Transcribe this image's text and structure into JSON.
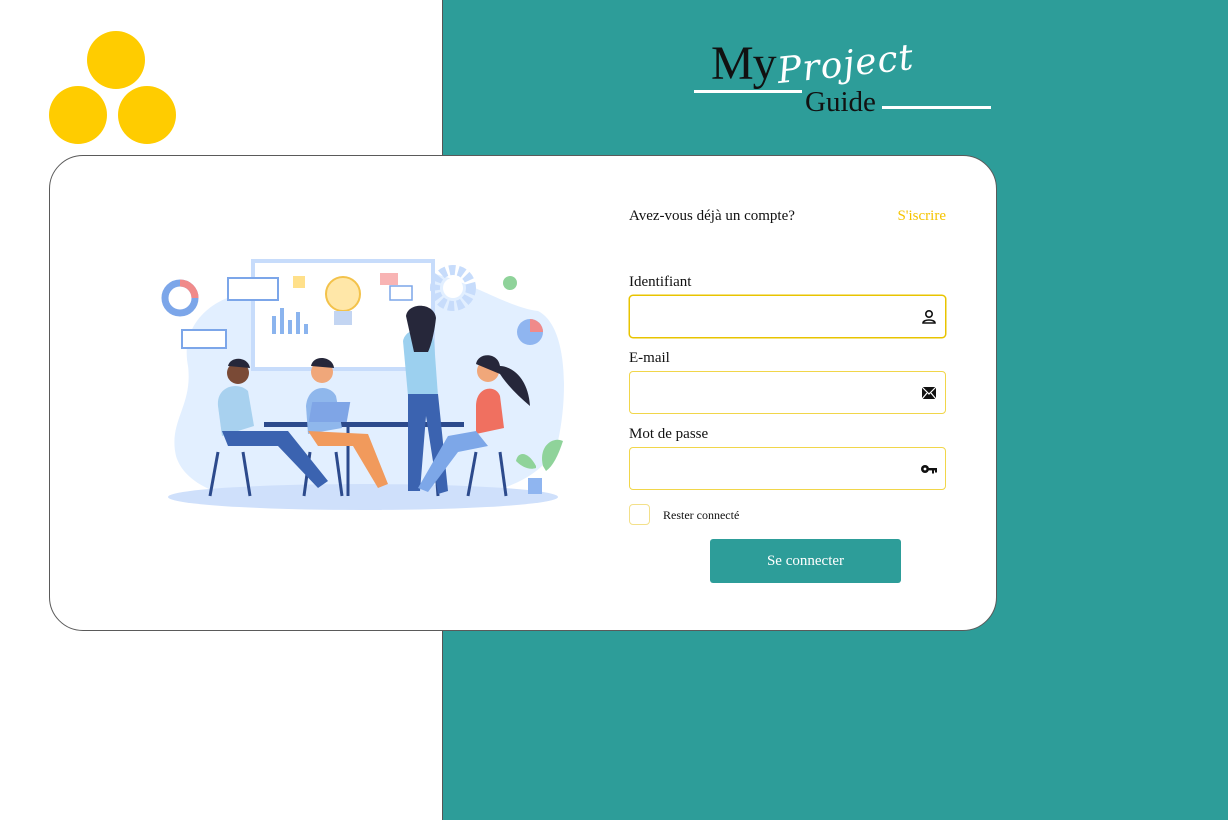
{
  "brand": {
    "my": "My",
    "project": "Project",
    "guide": "Guide"
  },
  "colors": {
    "accent_teal": "#2d9d99",
    "accent_yellow": "#ffcc00"
  },
  "login": {
    "question": "Avez-vous déjà un compte?",
    "signup_link": "S'iscrire",
    "fields": [
      {
        "label": "Identifiant",
        "value": "",
        "icon": "user-icon"
      },
      {
        "label": "E-mail",
        "value": "",
        "icon": "mail-icon"
      },
      {
        "label": "Mot de passe",
        "value": "",
        "icon": "key-icon"
      }
    ],
    "remember_label": "Rester connecté",
    "remember_checked": false,
    "submit_label": "Se connecter"
  }
}
